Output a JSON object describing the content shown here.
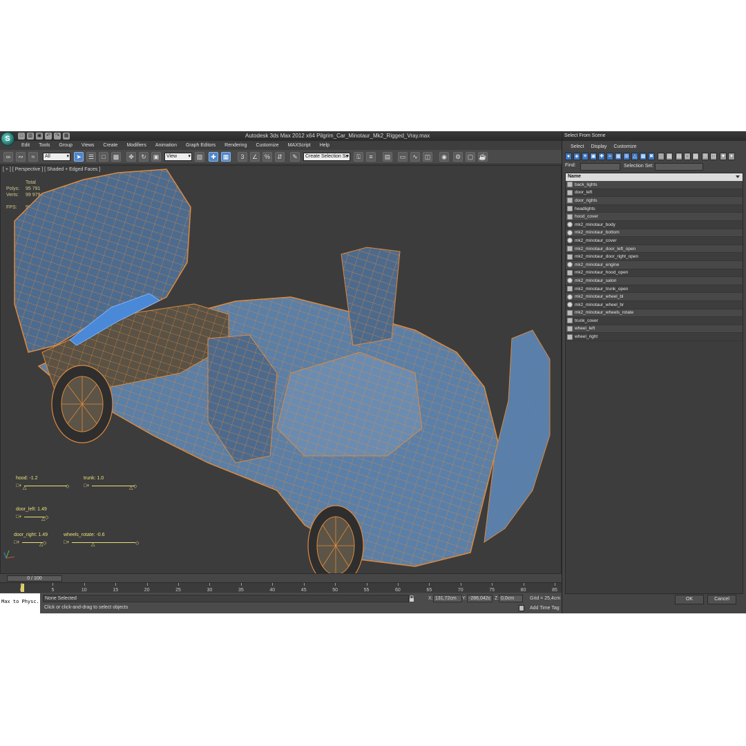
{
  "window": {
    "title": "Autodesk 3ds Max  2012 x64      Pilgrim_Car_Minotaur_Mk2_Rigged_Vray.max",
    "logo_icon": "3ds-max-logo-icon"
  },
  "menu": [
    "Edit",
    "Tools",
    "Group",
    "Views",
    "Create",
    "Modifiers",
    "Animation",
    "Graph Editors",
    "Rendering",
    "Customize",
    "MAXScript",
    "Help"
  ],
  "toolbar": {
    "selection_filter": "All",
    "reference_coord": "View",
    "named_selection": "Create Selection Se"
  },
  "viewport": {
    "label": "[ + ] [ Perspective ] [ Shaded + Edged Faces ]",
    "stats": {
      "header": "Total",
      "polys_label": "Polys:",
      "polys": "95 791",
      "verts_label": "Verts:",
      "verts": "99 979",
      "fps_label": "FPS:",
      "fps": "98,049"
    },
    "controls": [
      {
        "name": "hood",
        "label": "hood: -1.2"
      },
      {
        "name": "trunk",
        "label": "trunk: 1.0"
      },
      {
        "name": "door-left",
        "label": "door_left: 1.49"
      },
      {
        "name": "door-right",
        "label": "door_right: 1.49"
      },
      {
        "name": "wheels-rotate",
        "label": "wheels_rotate: -0.6"
      }
    ],
    "colors": {
      "background": "#3c3c3c",
      "mesh_fill": "#5b7fa6",
      "edge_orange": "#e08a3c",
      "edge_blue": "#4a88d8"
    }
  },
  "timeline": {
    "slider": "0 / 100",
    "ticks": [
      "0",
      "5",
      "10",
      "15",
      "20",
      "25",
      "30",
      "35",
      "40",
      "45",
      "50",
      "55",
      "60",
      "65",
      "70",
      "75",
      "80",
      "85"
    ]
  },
  "status": {
    "listener": "Max to Physc.",
    "selection": "None Selected",
    "prompt": "Click or click-and-drag to select objects",
    "x_label": "X:",
    "x": "131,72cm",
    "y_label": "Y:",
    "y": "-286,042c",
    "z_label": "Z:",
    "z": "0,0cm",
    "grid": "Grid = 25,4cm",
    "add_time_tag": "Add Time Tag"
  },
  "dialog": {
    "title": "Select From Scene",
    "menu": [
      "Select",
      "Display",
      "Customize"
    ],
    "find_label": "Find:",
    "selection_set_label": "Selection Set:",
    "column": "Name",
    "items": [
      {
        "name": "back_lights",
        "icon": "group-icon"
      },
      {
        "name": "door_left",
        "icon": "group-icon"
      },
      {
        "name": "door_rights",
        "icon": "group-icon"
      },
      {
        "name": "headlights",
        "icon": "group-icon"
      },
      {
        "name": "hood_cover",
        "icon": "group-icon"
      },
      {
        "name": "mk2_minotaur_body",
        "icon": "geometry-icon"
      },
      {
        "name": "mk2_minotaur_bottom",
        "icon": "geometry-icon"
      },
      {
        "name": "mk2_minotaur_cover",
        "icon": "geometry-icon"
      },
      {
        "name": "mk2_minotaur_door_left_open",
        "icon": "group-icon"
      },
      {
        "name": "mk2_minotaur_door_right_open",
        "icon": "group-icon"
      },
      {
        "name": "mk2_minotaur_engine",
        "icon": "geometry-icon"
      },
      {
        "name": "mk2_minotaur_hood_open",
        "icon": "group-icon"
      },
      {
        "name": "mk2_minotaur_salon",
        "icon": "geometry-icon"
      },
      {
        "name": "mk2_minotaur_trunk_open",
        "icon": "group-icon"
      },
      {
        "name": "mk2_minotaur_wheel_bl",
        "icon": "geometry-icon"
      },
      {
        "name": "mk2_minotaur_wheel_br",
        "icon": "geometry-icon"
      },
      {
        "name": "mk2_minotaur_wheels_rotate",
        "icon": "group-icon"
      },
      {
        "name": "trunk_cover",
        "icon": "group-icon"
      },
      {
        "name": "wheel_left",
        "icon": "group-icon"
      },
      {
        "name": "wheel_right",
        "icon": "group-icon"
      }
    ],
    "ok_label": "OK",
    "cancel_label": "Cancel"
  }
}
